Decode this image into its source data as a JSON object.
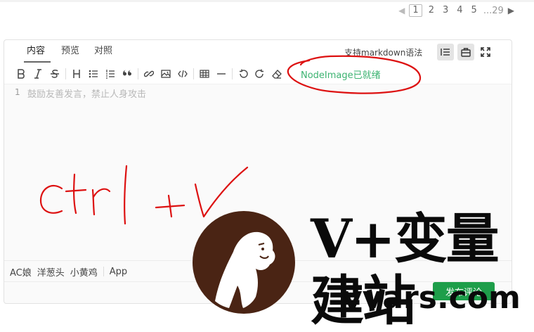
{
  "pagination": {
    "prev_icon": "triangle-left-icon",
    "next_icon": "triangle-right-icon",
    "pages": [
      "1",
      "2",
      "3",
      "4",
      "5"
    ],
    "ellipsis": "...",
    "last": "29",
    "current": "1"
  },
  "editor": {
    "tabs": [
      {
        "label": "内容",
        "active": true
      },
      {
        "label": "预览",
        "active": false
      },
      {
        "label": "对照",
        "active": false
      }
    ],
    "markdown_support": "支持markdown语法",
    "view_buttons": [
      "list-icon",
      "toolbox-icon",
      "fullscreen-icon"
    ],
    "toolbar": {
      "groups": [
        [
          "bold-icon",
          "italic-icon",
          "strikethrough-icon"
        ],
        [
          "heading-icon",
          "bullet-list-icon",
          "numbered-list-icon",
          "quote-icon"
        ],
        [
          "link-icon",
          "image-icon",
          "code-icon"
        ],
        [
          "table-icon",
          "horizontal-rule-icon"
        ],
        [
          "undo-icon",
          "redo-icon",
          "eraser-icon"
        ]
      ],
      "status": "NodeImage已就绪"
    },
    "line_number": "1",
    "placeholder": "鼓励友善发言，禁止人身攻击",
    "emoji_tabs": [
      "AC娘",
      "洋葱头",
      "小黄鸡",
      "App"
    ],
    "submit_label": "发布评论"
  },
  "annotation": {
    "handwriting": "ctrl + v",
    "color": "#dd1111"
  },
  "watermark": {
    "title": "V+变量建站",
    "url": "vvars.com",
    "logo_color": "#4a2414"
  }
}
